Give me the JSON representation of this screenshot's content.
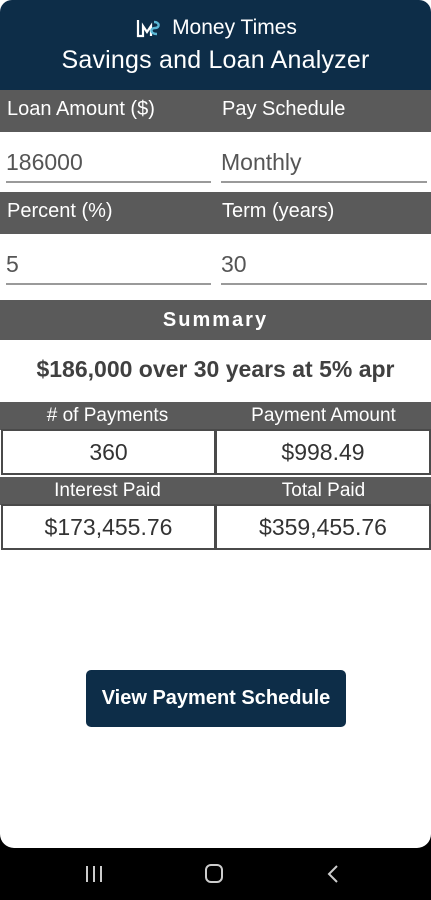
{
  "header": {
    "brand": "Money Times",
    "title": "Savings and Loan Analyzer",
    "logo_icon": "money-times-logo-icon"
  },
  "inputs": {
    "loan_amount": {
      "label": "Loan Amount ($)",
      "value": "186000"
    },
    "pay_schedule": {
      "label": "Pay Schedule",
      "value": "Monthly"
    },
    "percent": {
      "label": "Percent (%)",
      "value": "5"
    },
    "term": {
      "label": "Term (years)",
      "value": "30"
    }
  },
  "summary": {
    "heading": "Summary",
    "sentence": "$186,000 over 30 years at 5% apr",
    "num_payments_label": "# of Payments",
    "num_payments_value": "360",
    "payment_amount_label": "Payment Amount",
    "payment_amount_value": "$998.49",
    "interest_paid_label": "Interest Paid",
    "interest_paid_value": "$173,455.76",
    "total_paid_label": "Total Paid",
    "total_paid_value": "$359,455.76"
  },
  "actions": {
    "view_schedule_label": "View Payment Schedule"
  },
  "navbar": {
    "icons": [
      "recent-apps-icon",
      "home-icon",
      "back-icon"
    ]
  },
  "colors": {
    "primary": "#0d2d48",
    "label_bar": "#5a5a5a"
  }
}
